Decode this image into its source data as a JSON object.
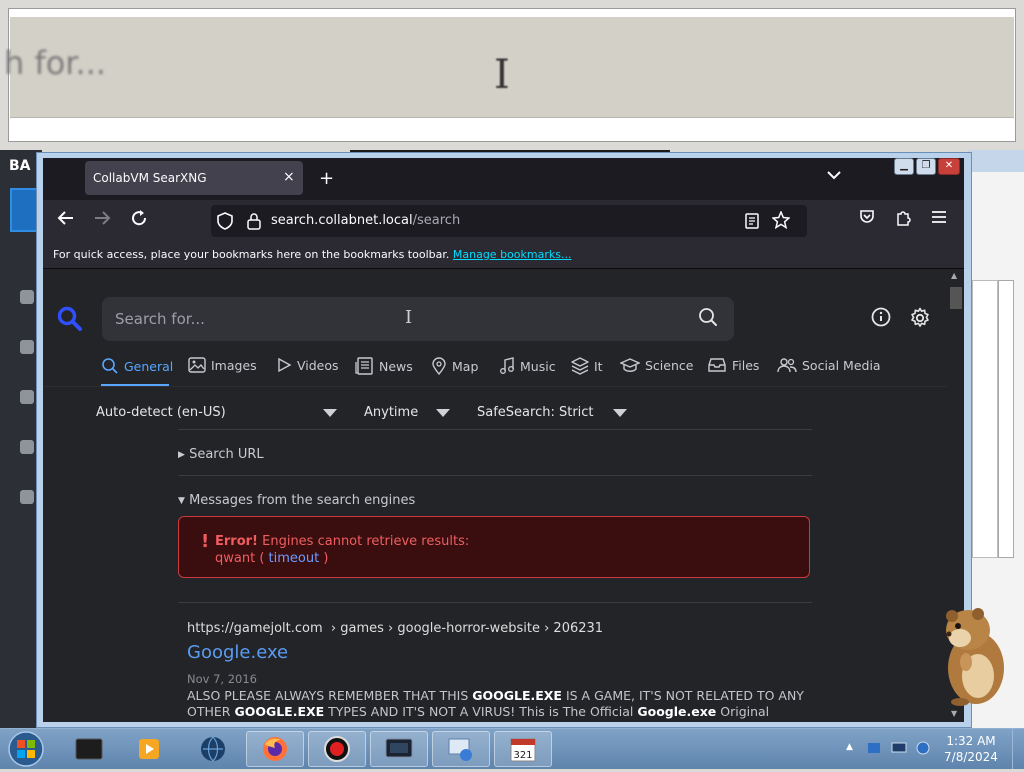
{
  "background": {
    "search_text": "h for...",
    "app_label": "BA"
  },
  "browser": {
    "tab_title": "CollabVM SearXNG",
    "tab_close": "×",
    "new_tab": "+",
    "url_domain": "search.collabnet.local",
    "url_path": "/search",
    "bookmarks_text": "For quick access, place your bookmarks here on the bookmarks toolbar.",
    "bookmarks_link": "Manage bookmarks..."
  },
  "search": {
    "placeholder": "Search for...",
    "categories": [
      "General",
      "Images",
      "Videos",
      "News",
      "Map",
      "Music",
      "It",
      "Science",
      "Files",
      "Social Media"
    ],
    "filters": {
      "language": "Auto-detect (en-US)",
      "time": "Anytime",
      "safesearch": "SafeSearch: Strict"
    },
    "search_url_label": "Search URL",
    "messages_label": "Messages from the search engines",
    "error": {
      "bold": "Error!",
      "message": "Engines cannot retrieve results:",
      "engine": "qwant",
      "open_paren": "(",
      "link": "timeout",
      "close_paren": ")"
    }
  },
  "result": {
    "url_host": "https://gamejolt.com",
    "url_path": "› games › google-horror-website › 206231",
    "title": "Google.exe",
    "date": "Nov 7, 2016",
    "snippet_1": "ALSO PLEASE ALWAYS REMEMBER THAT THIS ",
    "snippet_b1": "GOOGLE.EXE",
    "snippet_2": " IS A GAME, IT'S NOT RELATED TO ANY OTHER ",
    "snippet_b2": "GOOGLE.EXE",
    "snippet_3": " TYPES AND IT'S NOT A VIRUS! This is The Official ",
    "snippet_b3": "Google.exe",
    "snippet_4": " Original"
  },
  "taskbar": {
    "time": "1:32 AM",
    "date": "7/8/2024"
  },
  "colors": {
    "accent": "#58a6ff",
    "error": "#f05d61",
    "page_bg": "#222428"
  }
}
